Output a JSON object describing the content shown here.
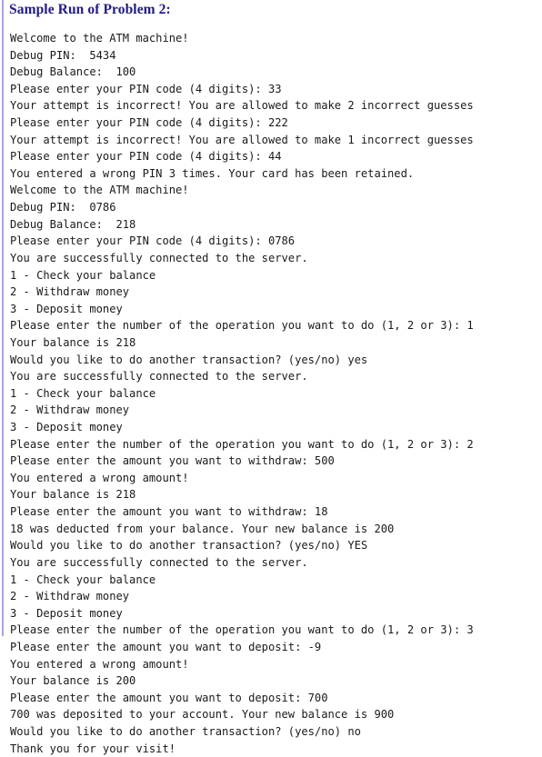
{
  "colors": {
    "background": "#ffffff",
    "heading_text": "#1f1a8c",
    "console_text": "#1a1a1a",
    "left_rule": "#a9a3e0"
  },
  "heading": {
    "text": "Sample Run of Problem 2:"
  },
  "console": {
    "lines": [
      "Welcome to the ATM machine!",
      "Debug PIN:  5434",
      "Debug Balance:  100",
      "Please enter your PIN code (4 digits): 33",
      "Your attempt is incorrect! You are allowed to make 2 incorrect guesses",
      "Please enter your PIN code (4 digits): 222",
      "Your attempt is incorrect! You are allowed to make 1 incorrect guesses",
      "Please enter your PIN code (4 digits): 44",
      "You entered a wrong PIN 3 times. Your card has been retained.",
      "Welcome to the ATM machine!",
      "Debug PIN:  0786",
      "Debug Balance:  218",
      "Please enter your PIN code (4 digits): 0786",
      "You are successfully connected to the server.",
      "1 - Check your balance",
      "2 - Withdraw money",
      "3 - Deposit money",
      "Please enter the number of the operation you want to do (1, 2 or 3): 1",
      "Your balance is 218",
      "Would you like to do another transaction? (yes/no) yes",
      "You are successfully connected to the server.",
      "1 - Check your balance",
      "2 - Withdraw money",
      "3 - Deposit money",
      "Please enter the number of the operation you want to do (1, 2 or 3): 2",
      "Please enter the amount you want to withdraw: 500",
      "You entered a wrong amount!",
      "Your balance is 218",
      "Please enter the amount you want to withdraw: 18",
      "18 was deducted from your balance. Your new balance is 200",
      "Would you like to do another transaction? (yes/no) YES",
      "You are successfully connected to the server.",
      "1 - Check your balance",
      "2 - Withdraw money",
      "3 - Deposit money",
      "Please enter the number of the operation you want to do (1, 2 or 3): 3",
      "Please enter the amount you want to deposit: -9",
      "You entered a wrong amount!",
      "Your balance is 200",
      "Please enter the amount you want to deposit: 700",
      "700 was deposited to your account. Your new balance is 900",
      "Would you like to do another transaction? (yes/no) no",
      "Thank you for your visit!"
    ]
  }
}
